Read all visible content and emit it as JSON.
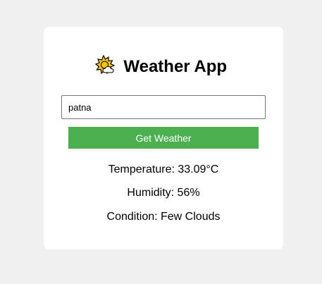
{
  "app": {
    "title": "Weather App",
    "logo_icon": "sun-behind-cloud-icon"
  },
  "search": {
    "value": "patna",
    "button_label": "Get Weather"
  },
  "results": {
    "temperature": "Temperature: 33.09°C",
    "humidity": "Humidity: 56%",
    "condition": "Condition: Few Clouds"
  },
  "colors": {
    "page_background": "#f0f0f0",
    "card_background": "#ffffff",
    "button_background": "#4caf50",
    "button_text": "#ffffff"
  }
}
